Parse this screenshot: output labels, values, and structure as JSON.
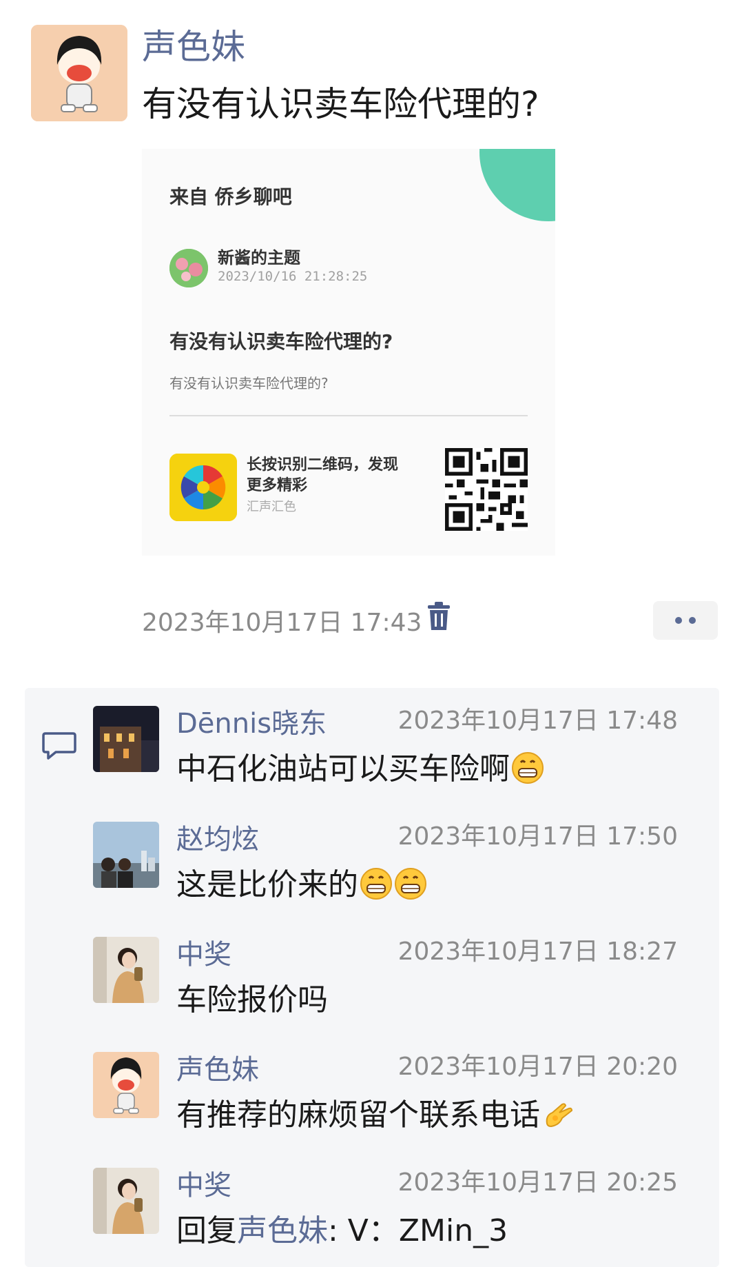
{
  "post": {
    "author": "声色妹",
    "text": "有没有认识卖车险代理的?",
    "timestamp": "2023年10月17日 17:43",
    "actions": {
      "delete_icon": "trash-icon",
      "more_icon": "more-dots-icon"
    }
  },
  "shared_card": {
    "source": "来自 侨乡聊吧",
    "author": "新酱的主题",
    "author_time": "2023/10/16 21:28:25",
    "title": "有没有认识卖车险代理的?",
    "body": "有没有认识卖车险代理的?",
    "cta": "长按识别二维码，发现更多精彩",
    "brand": "汇声汇色",
    "accent_color": "#5ecfaf"
  },
  "comments": [
    {
      "author": "Dēnnis晓东",
      "time": "2023年10月17日 17:48",
      "text": "中石化油站可以买车险啊",
      "emoji": [
        "grin-emoji"
      ]
    },
    {
      "author": "赵均炫",
      "time": "2023年10月17日 17:50",
      "text": "这是比价来的",
      "emoji": [
        "grin-emoji",
        "grin-emoji"
      ]
    },
    {
      "author": "中奖",
      "time": "2023年10月17日 18:27",
      "text": "车险报价吗",
      "emoji": []
    },
    {
      "author": "声色妹",
      "time": "2023年10月17日 20:20",
      "text": "有推荐的麻烦留个联系电话",
      "emoji": [
        "ok-hand-emoji"
      ]
    },
    {
      "author": "中奖",
      "time": "2023年10月17日 20:25",
      "reply_prefix": "回复",
      "reply_to": "声色妹",
      "text": ": V：ZMin_3",
      "emoji": []
    }
  ],
  "colors": {
    "name_link": "#5b6b95",
    "comments_bg": "#f5f6f8"
  }
}
